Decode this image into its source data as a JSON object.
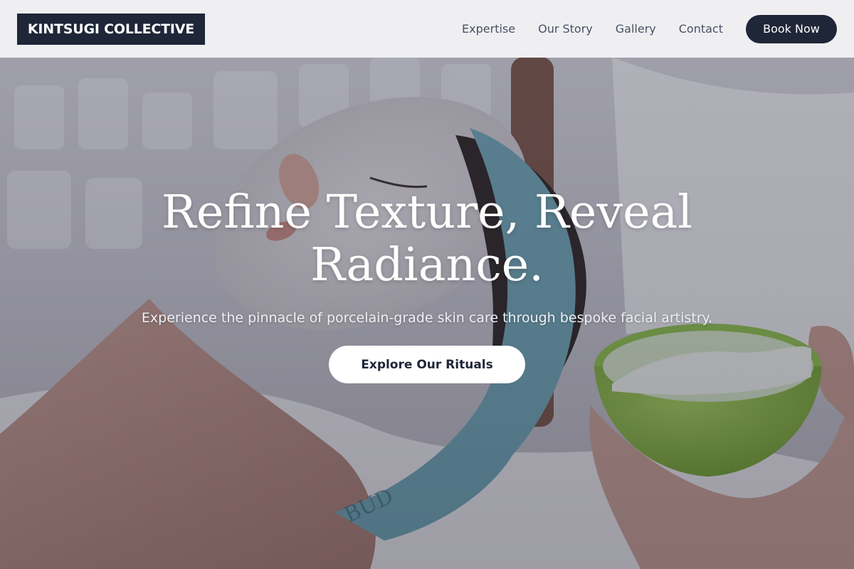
{
  "header": {
    "logo_text": "KINTSUGI COLLECTIVE",
    "nav": [
      {
        "label": "Expertise"
      },
      {
        "label": "Our Story"
      },
      {
        "label": "Gallery"
      },
      {
        "label": "Contact"
      }
    ],
    "book_label": "Book Now"
  },
  "hero": {
    "title": "Refine Texture, Reveal Radiance.",
    "subtitle": "Experience the pinnacle of porcelain-grade skin care through bespoke facial artistry.",
    "cta_label": "Explore Our Rituals",
    "background_image": "facial-treatment-photo"
  },
  "colors": {
    "brand_dark": "#1f2638",
    "nav_text": "#4a5063",
    "header_bg": "#f3f3f6",
    "cta_bg": "#ffffff"
  }
}
